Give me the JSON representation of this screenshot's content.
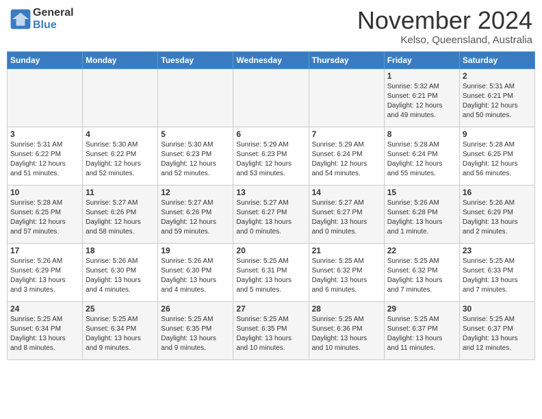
{
  "header": {
    "logo_general": "General",
    "logo_blue": "Blue",
    "month": "November 2024",
    "location": "Kelso, Queensland, Australia"
  },
  "days_of_week": [
    "Sunday",
    "Monday",
    "Tuesday",
    "Wednesday",
    "Thursday",
    "Friday",
    "Saturday"
  ],
  "weeks": [
    {
      "days": [
        {
          "num": "",
          "info": ""
        },
        {
          "num": "",
          "info": ""
        },
        {
          "num": "",
          "info": ""
        },
        {
          "num": "",
          "info": ""
        },
        {
          "num": "",
          "info": ""
        },
        {
          "num": "1",
          "info": "Sunrise: 5:32 AM\nSunset: 6:21 PM\nDaylight: 12 hours\nand 49 minutes."
        },
        {
          "num": "2",
          "info": "Sunrise: 5:31 AM\nSunset: 6:21 PM\nDaylight: 12 hours\nand 50 minutes."
        }
      ]
    },
    {
      "days": [
        {
          "num": "3",
          "info": "Sunrise: 5:31 AM\nSunset: 6:22 PM\nDaylight: 12 hours\nand 51 minutes."
        },
        {
          "num": "4",
          "info": "Sunrise: 5:30 AM\nSunset: 6:22 PM\nDaylight: 12 hours\nand 52 minutes."
        },
        {
          "num": "5",
          "info": "Sunrise: 5:30 AM\nSunset: 6:23 PM\nDaylight: 12 hours\nand 52 minutes."
        },
        {
          "num": "6",
          "info": "Sunrise: 5:29 AM\nSunset: 6:23 PM\nDaylight: 12 hours\nand 53 minutes."
        },
        {
          "num": "7",
          "info": "Sunrise: 5:29 AM\nSunset: 6:24 PM\nDaylight: 12 hours\nand 54 minutes."
        },
        {
          "num": "8",
          "info": "Sunrise: 5:28 AM\nSunset: 6:24 PM\nDaylight: 12 hours\nand 55 minutes."
        },
        {
          "num": "9",
          "info": "Sunrise: 5:28 AM\nSunset: 6:25 PM\nDaylight: 12 hours\nand 56 minutes."
        }
      ]
    },
    {
      "days": [
        {
          "num": "10",
          "info": "Sunrise: 5:28 AM\nSunset: 6:25 PM\nDaylight: 12 hours\nand 57 minutes."
        },
        {
          "num": "11",
          "info": "Sunrise: 5:27 AM\nSunset: 6:26 PM\nDaylight: 12 hours\nand 58 minutes."
        },
        {
          "num": "12",
          "info": "Sunrise: 5:27 AM\nSunset: 6:26 PM\nDaylight: 12 hours\nand 59 minutes."
        },
        {
          "num": "13",
          "info": "Sunrise: 5:27 AM\nSunset: 6:27 PM\nDaylight: 13 hours\nand 0 minutes."
        },
        {
          "num": "14",
          "info": "Sunrise: 5:27 AM\nSunset: 6:27 PM\nDaylight: 13 hours\nand 0 minutes."
        },
        {
          "num": "15",
          "info": "Sunrise: 5:26 AM\nSunset: 6:28 PM\nDaylight: 13 hours\nand 1 minute."
        },
        {
          "num": "16",
          "info": "Sunrise: 5:26 AM\nSunset: 6:29 PM\nDaylight: 13 hours\nand 2 minutes."
        }
      ]
    },
    {
      "days": [
        {
          "num": "17",
          "info": "Sunrise: 5:26 AM\nSunset: 6:29 PM\nDaylight: 13 hours\nand 3 minutes."
        },
        {
          "num": "18",
          "info": "Sunrise: 5:26 AM\nSunset: 6:30 PM\nDaylight: 13 hours\nand 4 minutes."
        },
        {
          "num": "19",
          "info": "Sunrise: 5:26 AM\nSunset: 6:30 PM\nDaylight: 13 hours\nand 4 minutes."
        },
        {
          "num": "20",
          "info": "Sunrise: 5:25 AM\nSunset: 6:31 PM\nDaylight: 13 hours\nand 5 minutes."
        },
        {
          "num": "21",
          "info": "Sunrise: 5:25 AM\nSunset: 6:32 PM\nDaylight: 13 hours\nand 6 minutes."
        },
        {
          "num": "22",
          "info": "Sunrise: 5:25 AM\nSunset: 6:32 PM\nDaylight: 13 hours\nand 7 minutes."
        },
        {
          "num": "23",
          "info": "Sunrise: 5:25 AM\nSunset: 6:33 PM\nDaylight: 13 hours\nand 7 minutes."
        }
      ]
    },
    {
      "days": [
        {
          "num": "24",
          "info": "Sunrise: 5:25 AM\nSunset: 6:34 PM\nDaylight: 13 hours\nand 8 minutes."
        },
        {
          "num": "25",
          "info": "Sunrise: 5:25 AM\nSunset: 6:34 PM\nDaylight: 13 hours\nand 9 minutes."
        },
        {
          "num": "26",
          "info": "Sunrise: 5:25 AM\nSunset: 6:35 PM\nDaylight: 13 hours\nand 9 minutes."
        },
        {
          "num": "27",
          "info": "Sunrise: 5:25 AM\nSunset: 6:35 PM\nDaylight: 13 hours\nand 10 minutes."
        },
        {
          "num": "28",
          "info": "Sunrise: 5:25 AM\nSunset: 6:36 PM\nDaylight: 13 hours\nand 10 minutes."
        },
        {
          "num": "29",
          "info": "Sunrise: 5:25 AM\nSunset: 6:37 PM\nDaylight: 13 hours\nand 11 minutes."
        },
        {
          "num": "30",
          "info": "Sunrise: 5:25 AM\nSunset: 6:37 PM\nDaylight: 13 hours\nand 12 minutes."
        }
      ]
    }
  ]
}
